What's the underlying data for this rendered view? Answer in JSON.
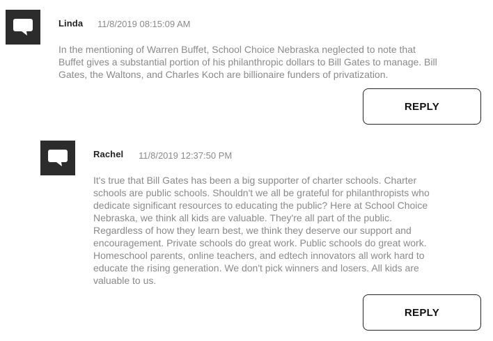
{
  "comments": [
    {
      "author": "Linda",
      "timestamp": "11/8/2019 08:15:09 AM",
      "avatar_icon": "speech-bubble-icon",
      "lines": [
        "In the mentioning of Warren Buffet, School Choice Nebraska neglected to note that",
        "Buffet gives a substantial portion of his philanthropic dollars to Bill Gates to manage. Bill",
        "Gates, the Waltons, and Charles Koch are billionaire funders of privatization."
      ],
      "reply_label": "REPLY"
    },
    {
      "author": "Rachel",
      "timestamp": "11/8/2019 12:37:50 PM",
      "avatar_icon": "speech-bubble-icon",
      "lines": [
        "It's true that Bill Gates has been a big supporter of charter schools. Charter",
        "schools are public schools. Shouldn't we all be grateful for philanthropists who",
        "dedicate significant resources to educating the public? Here at School Choice",
        "Nebraska, we think all kids are valuable. They're all part of the public.",
        "Regardless of how they learn best, we think they deserve our support and",
        "encouragement. Private schools do great work. Public schools do great work.",
        "Homeschool parents, online teachers, and edtech innovators all work hard to",
        "educate the rising generation. We don't pick winners and losers. All kids are",
        "valuable to us."
      ],
      "reply_label": "REPLY"
    }
  ],
  "colors": {
    "avatar_bg": "#2c2c2c",
    "author_text": "#222222",
    "muted_text": "#8a8a8a",
    "button_border": "#222222"
  }
}
